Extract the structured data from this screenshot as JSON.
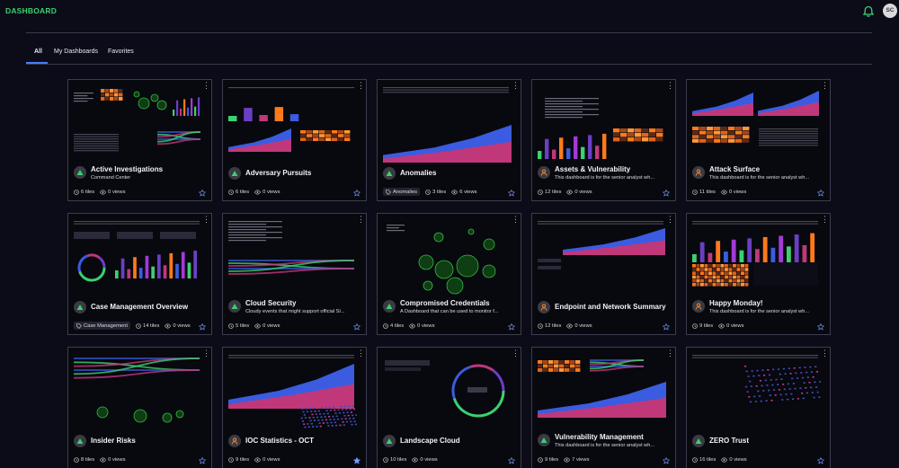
{
  "app": {
    "title": "DASHBOARD",
    "user_initials": "SC"
  },
  "tabs": [
    {
      "label": "All",
      "active": true
    },
    {
      "label": "My Dashboards",
      "active": false
    },
    {
      "label": "Favorites",
      "active": false
    }
  ],
  "cards": [
    {
      "title": "Active Investigations",
      "subtitle": "Command Center",
      "tiles": "6 tiles",
      "views": "0 views",
      "tag": "",
      "icon": "green-triangle",
      "favorite": false
    },
    {
      "title": "Adversary Pursuits",
      "subtitle": "",
      "tiles": "6 tiles",
      "views": "0 views",
      "tag": "",
      "icon": "green-triangle",
      "favorite": false
    },
    {
      "title": "Anomalies",
      "subtitle": "",
      "tiles": "3 tiles",
      "views": "6 views",
      "tag": "Anomalies",
      "icon": "green-triangle",
      "favorite": false
    },
    {
      "title": "Assets & Vulnerability",
      "subtitle": "This dashboard is for the senior analyst wh...",
      "tiles": "12 tiles",
      "views": "0 views",
      "tag": "",
      "icon": "orange-person",
      "favorite": false
    },
    {
      "title": "Attack Surface",
      "subtitle": "This dashboard is for the senior analyst wh...",
      "tiles": "11 tiles",
      "views": "0 views",
      "tag": "",
      "icon": "orange-person",
      "favorite": false
    },
    {
      "title": "Case Management Overview",
      "subtitle": "",
      "tiles": "14 tiles",
      "views": "0 views",
      "tag": "Case Management",
      "icon": "green-triangle",
      "favorite": false
    },
    {
      "title": "Cloud Security",
      "subtitle": "Cloudy events that might support official SI...",
      "tiles": "5 tiles",
      "views": "0 views",
      "tag": "",
      "icon": "green-triangle",
      "favorite": false
    },
    {
      "title": "Compromised Credentials",
      "subtitle": "A Dashboard that can be used to monitor f...",
      "tiles": "4 tiles",
      "views": "0 views",
      "tag": "",
      "icon": "green-triangle",
      "favorite": false
    },
    {
      "title": "Endpoint and Network Summary",
      "subtitle": "",
      "tiles": "12 tiles",
      "views": "0 views",
      "tag": "",
      "icon": "orange-person",
      "favorite": false
    },
    {
      "title": "Happy Monday!",
      "subtitle": "This dashboard is for the senior analyst wh...",
      "tiles": "9 tiles",
      "views": "0 views",
      "tag": "",
      "icon": "orange-person",
      "favorite": false
    },
    {
      "title": "Insider Risks",
      "subtitle": "",
      "tiles": "8 tiles",
      "views": "0 views",
      "tag": "",
      "icon": "green-triangle",
      "favorite": false
    },
    {
      "title": "IOC Statistics - OCT",
      "subtitle": "",
      "tiles": "9 tiles",
      "views": "0 views",
      "tag": "",
      "icon": "orange-person",
      "favorite": true
    },
    {
      "title": "Landscape Cloud",
      "subtitle": "",
      "tiles": "10 tiles",
      "views": "0 views",
      "tag": "",
      "icon": "green-triangle",
      "favorite": false
    },
    {
      "title": "Vulnerability Management",
      "subtitle": "This dashboard is for the senior analyst wh...",
      "tiles": "9 tiles",
      "views": "7 views",
      "tag": "",
      "icon": "green-triangle",
      "favorite": false
    },
    {
      "title": "ZERO Trust",
      "subtitle": "",
      "tiles": "16 tiles",
      "views": "0 views",
      "tag": "",
      "icon": "green-triangle",
      "favorite": false
    }
  ],
  "colors": {
    "brand": "#3bd16f",
    "accent": "#4b7cff",
    "orange": "#ff7a1a",
    "green": "#3bd16f",
    "purple": "#6a3fc4",
    "magenta": "#c0387a",
    "blue": "#3b5ce0"
  }
}
